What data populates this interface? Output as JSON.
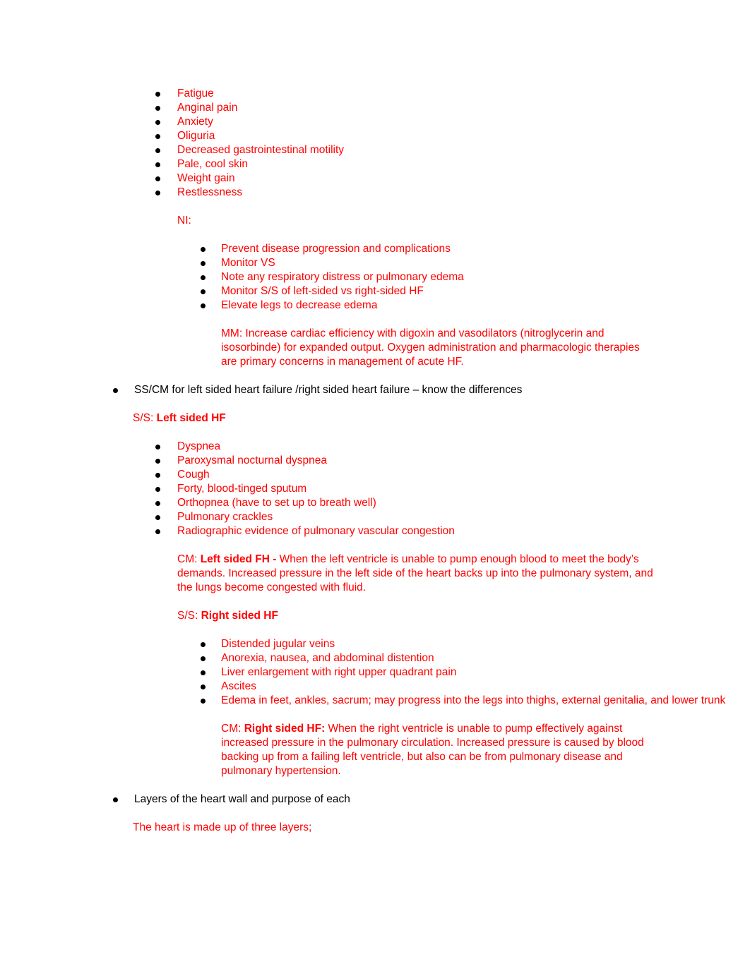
{
  "document": {
    "accent_color": "#ff0000",
    "text_color": "#000000",
    "background_color": "#ffffff",
    "sections": {
      "hf_general_signs": {
        "items": [
          "Fatigue",
          "Anginal pain",
          "Anxiety",
          "Oliguria",
          "Decreased gastrointestinal motility",
          "Pale, cool skin",
          "Weight gain",
          "Restlessness"
        ]
      },
      "nursing_interventions": {
        "heading": "NI:",
        "items": [
          "Prevent disease progression and complications",
          "Monitor VS",
          "Note any respiratory distress or pulmonary edema",
          "Monitor S/S of left-sided vs right-sided HF",
          "Elevate legs to decrease edema"
        ],
        "medical_management": "MM: Increase cardiac efficiency with digoxin and vasodilators (nitroglycerin and isosorbinde) for expanded output. Oxygen administration and pharmacologic therapies are primary concerns in management of acute HF."
      },
      "ss_cm_topic": {
        "bullet": "SS/CM for left sided heart failure /right sided heart failure – know the differences"
      },
      "left_sided_hf": {
        "label": "S/S: ",
        "label_bold": "Left sided HF",
        "items": [
          "Dyspnea",
          "Paroxysmal nocturnal dyspnea",
          "Cough",
          "Forty, blood-tinged sputum",
          "Orthopnea (have to set up to breath well)",
          "Pulmonary crackles",
          "Radiographic evidence of pulmonary vascular congestion"
        ],
        "cm_prefix": "CM: ",
        "cm_bold": "Left sided FH -",
        "cm_body": " When the left ventricle is unable to pump enough blood to meet the body’s demands. Increased pressure in the left side of the heart backs up into the pulmonary system, and the lungs become congested with fluid."
      },
      "right_sided_hf": {
        "label": "S/S: ",
        "label_bold": "Right sided HF",
        "items": [
          "Distended jugular veins",
          "Anorexia, nausea, and abdominal distention",
          "Liver enlargement with right upper quadrant pain",
          "Ascites",
          "Edema in feet, ankles, sacrum; may progress into the legs into thighs, external genitalia, and lower trunk"
        ],
        "cm_prefix": "CM: ",
        "cm_bold": "Right sided HF:",
        "cm_body": " When the right ventricle is unable to pump effectively against increased pressure in the pulmonary circulation. Increased pressure is caused by blood backing up from a failing left ventricle, but also can be from pulmonary disease and pulmonary hypertension."
      },
      "heart_layers": {
        "bullet": "Layers of the heart wall and purpose of each",
        "note": "The heart is made up of three layers;"
      }
    }
  }
}
